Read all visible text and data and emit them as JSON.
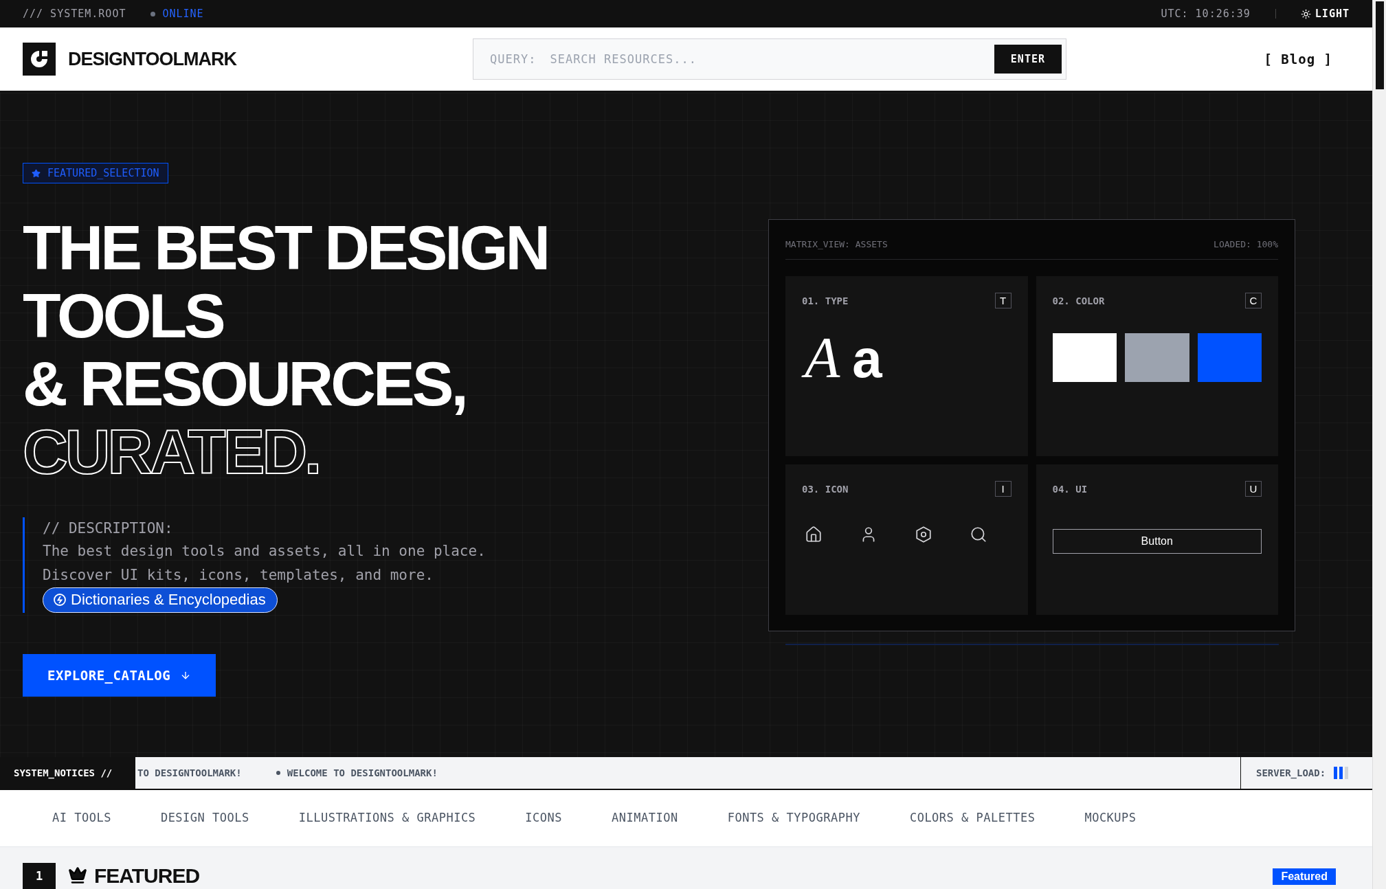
{
  "top_bar": {
    "path": "/// SYSTEM.ROOT",
    "status": {
      "label": "ONLINE",
      "online": true
    },
    "time": "UTC: 10:26:39",
    "theme_toggle": "LIGHT"
  },
  "header": {
    "brand": "DESIGNTOOLMARK",
    "search": {
      "label": "QUERY:",
      "placeholder": "SEARCH RESOURCES...",
      "button": "ENTER"
    },
    "nav_link": "[ Blog ]"
  },
  "hero": {
    "badge": "FEATURED_SELECTION",
    "headline": [
      {
        "text": "THE BEST DESIGN",
        "kind": "solid"
      },
      {
        "text": "TOOLS",
        "kind": "solid"
      },
      {
        "text": "& RESOURCES,",
        "kind": "solid"
      },
      {
        "text": "CURATED.",
        "kind": "outline"
      }
    ],
    "description": {
      "label": "// DESCRIPTION:",
      "lines": [
        "The best design tools and assets, all in one place.",
        "Discover UI kits, icons, templates, and more."
      ],
      "tag": "Dictionaries & Encyclopedias"
    },
    "cta": "EXPLORE_CATALOG"
  },
  "matrix": {
    "title": "MATRIX_VIEW: ASSETS",
    "loaded": "LOADED: 100%",
    "cells": [
      {
        "kind": "type",
        "title": "01. TYPE",
        "key": "T",
        "serif": "A",
        "sans": "a"
      },
      {
        "kind": "color",
        "title": "02. COLOR",
        "key": "C",
        "swatches": [
          {
            "color": "#ffffff"
          },
          {
            "color": "#9ca3af"
          },
          {
            "color": "#0052ff"
          }
        ]
      },
      {
        "kind": "icon",
        "title": "03. ICON",
        "key": "I"
      },
      {
        "kind": "ui",
        "title": "04. UI",
        "key": "U",
        "button": "Button"
      }
    ]
  },
  "notices": {
    "label": "SYSTEM_NOTICES //",
    "messages": [
      "TO DESIGNTOOLMARK!",
      "WELCOME TO DESIGNTOOLMARK!"
    ],
    "server_load": {
      "label": "SERVER_LOAD:",
      "level": 0.67
    }
  },
  "categories": [
    {
      "label": "AI TOOLS",
      "selected": false
    },
    {
      "label": "DESIGN TOOLS",
      "selected": false
    },
    {
      "label": "ILLUSTRATIONS & GRAPHICS",
      "selected": false
    },
    {
      "label": "ICONS",
      "selected": false
    },
    {
      "label": "ANIMATION",
      "selected": false
    },
    {
      "label": "FONTS & TYPOGRAPHY",
      "selected": false
    },
    {
      "label": "COLORS & PALETTES",
      "selected": false
    },
    {
      "label": "MOCKUPS",
      "selected": false
    }
  ],
  "featured": {
    "rank": "1",
    "title": "FEATURED",
    "badge": "Featured"
  }
}
